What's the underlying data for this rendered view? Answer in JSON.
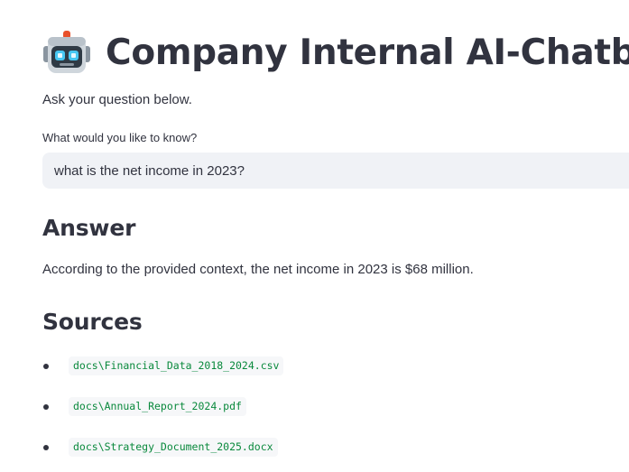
{
  "app": {
    "title": "Company Internal AI-Chatbot",
    "icon": "robot-icon",
    "subtitle": "Ask your question below."
  },
  "question": {
    "label": "What would you like to know?",
    "value": "what is the net income in 2023?"
  },
  "answer": {
    "heading": "Answer",
    "text": "According to the provided context, the net income in 2023 is $68 million."
  },
  "sources": {
    "heading": "Sources",
    "items": [
      "docs\\Financial_Data_2018_2024.csv",
      "docs\\Annual_Report_2024.pdf",
      "docs\\Strategy_Document_2025.docx"
    ]
  },
  "colors": {
    "text": "#31333f",
    "input_bg": "#f0f2f6",
    "code_text": "#09893c",
    "code_bg": "#f6f7f9"
  }
}
